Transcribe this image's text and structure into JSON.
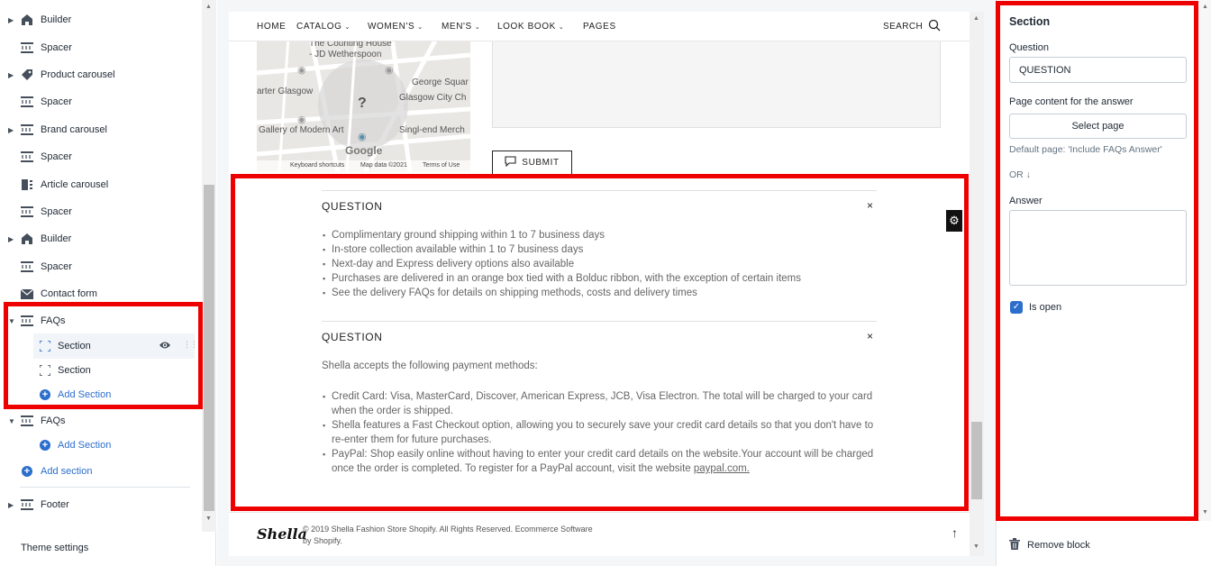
{
  "sidebar": {
    "items": [
      {
        "label": "Builder",
        "icon": "home-icon",
        "chevron": true
      },
      {
        "label": "Spacer",
        "icon": "spacer-icon",
        "chevron": false
      },
      {
        "label": "Product carousel",
        "icon": "tag-icon",
        "chevron": true
      },
      {
        "label": "Spacer",
        "icon": "spacer-icon",
        "chevron": false
      },
      {
        "label": "Brand carousel",
        "icon": "spacer-icon",
        "chevron": true
      },
      {
        "label": "Spacer",
        "icon": "spacer-icon",
        "chevron": false
      },
      {
        "label": "Article carousel",
        "icon": "article-icon",
        "chevron": false
      },
      {
        "label": "Spacer",
        "icon": "spacer-icon",
        "chevron": false
      },
      {
        "label": "Builder",
        "icon": "home-icon",
        "chevron": true
      },
      {
        "label": "Spacer",
        "icon": "spacer-icon",
        "chevron": false
      },
      {
        "label": "Contact form",
        "icon": "mail-icon",
        "chevron": false
      }
    ],
    "faqs1": {
      "label": "FAQs",
      "sections": [
        "Section",
        "Section"
      ],
      "add_section": "Add Section"
    },
    "faqs2": {
      "label": "FAQs",
      "add_section": "Add Section"
    },
    "add_section": "Add section",
    "footer": "Footer",
    "theme_settings": "Theme settings"
  },
  "preview": {
    "nav": {
      "items": [
        "HOME",
        "CATALOG",
        "WOMEN'S",
        "MEN'S",
        "LOOK BOOK",
        "PAGES"
      ],
      "search": "SEARCH"
    },
    "map": {
      "labels": [
        "The Counting House",
        "- JD Wetherspoon",
        "George Squar",
        "arter Glasgow",
        "Glasgow City Ch",
        "Gallery of Modern Art",
        "Singl-end Merch"
      ],
      "google": "Google",
      "footer": [
        "Keyboard shortcuts",
        "Map data ©2021",
        "Terms of Use"
      ]
    },
    "submit": "SUBMIT",
    "faq1": {
      "question": "QUESTION",
      "items": [
        "Complimentary ground shipping within 1 to 7 business days",
        "In-store collection available within 1 to 7 business days",
        "Next-day and Express delivery options also available",
        "Purchases are delivered in an orange box tied with a Bolduc ribbon, with the exception of certain items",
        "See the delivery FAQs for details on shipping methods, costs and delivery times"
      ]
    },
    "faq2": {
      "question": "QUESTION",
      "intro": "Shella accepts the following payment methods:",
      "items": [
        "Credit Card: Visa, MasterCard, Discover, American Express, JCB, Visa Electron. The total will be charged to your card when the order is shipped.",
        "Shella features a Fast Checkout option, allowing you to securely save your credit card details so that you don't have to re-enter them for future purchases.",
        "PayPal: Shop easily online without having to enter your credit card details on the website.Your account will be charged once the order is completed. To register for a PayPal account, visit the website "
      ],
      "link": "paypal.com."
    },
    "footer": {
      "logo": "Shella",
      "copyright": "© 2019 Shella Fashion Store Shopify. All Rights Reserved. Ecommerce Software by Shopify."
    }
  },
  "panel": {
    "title": "Section",
    "question_label": "Question",
    "question_value": "QUESTION",
    "page_content_label": "Page content for the answer",
    "select_page": "Select page",
    "default_page": "Default page: 'Include FAQs Answer'",
    "or": "OR ↓",
    "answer_label": "Answer",
    "answer_value": "",
    "is_open_label": "Is open",
    "is_open": true,
    "remove_block": "Remove block"
  },
  "colors": {
    "highlight": "#ee0000",
    "link_blue": "#2c6ecb"
  }
}
